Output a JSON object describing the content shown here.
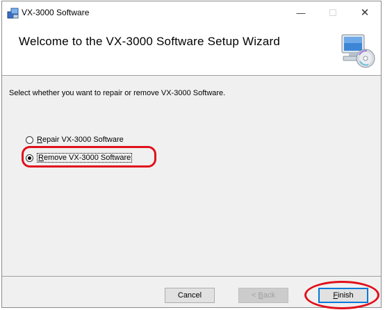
{
  "window": {
    "title": "VX-3000 Software",
    "controls": {
      "minimize": "—",
      "maximize": "☐",
      "close": "✕"
    }
  },
  "header": {
    "title": "Welcome to the VX-3000 Software Setup Wizard",
    "graphic_icon": "computer-with-disc-icon"
  },
  "body": {
    "instruction": "Select whether you want to repair or remove VX-3000 Software.",
    "options": [
      {
        "accel": "R",
        "rest": "epair VX-3000 Software",
        "selected": false
      },
      {
        "accel": "R",
        "rest": "emove VX-3000 Software",
        "selected": true
      }
    ]
  },
  "footer": {
    "cancel": "Cancel",
    "back_prefix": "< ",
    "back_accel": "B",
    "back_rest": "ack",
    "finish_accel": "F",
    "finish_rest": "inish"
  },
  "colors": {
    "highlight": "#e0101a",
    "default_button_border": "#0078d7"
  }
}
